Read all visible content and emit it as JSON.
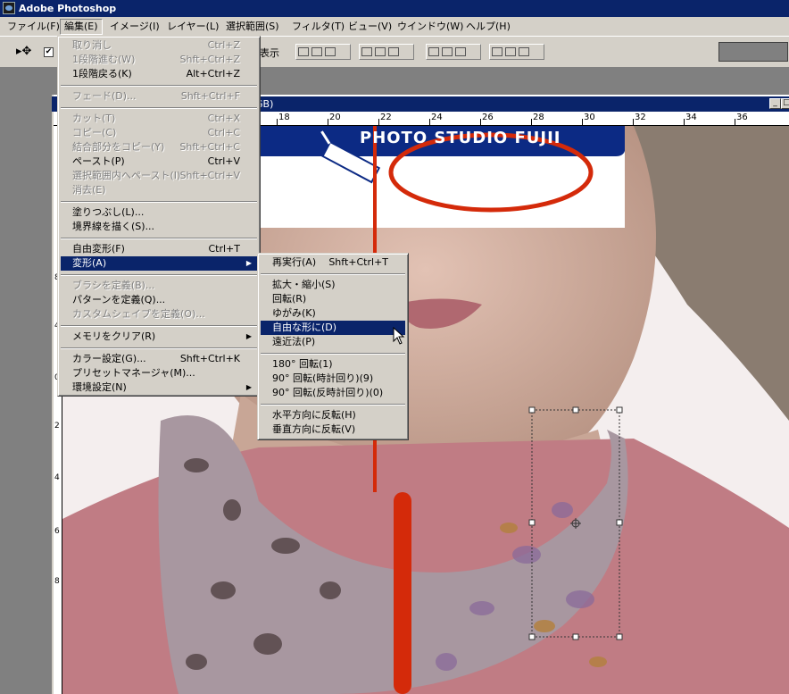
{
  "app": {
    "title": "Adobe Photoshop"
  },
  "menubar": [
    {
      "label": "ファイル(F)",
      "active": false
    },
    {
      "label": "編集(E)",
      "active": true
    },
    {
      "label": "イメージ(I)",
      "active": false
    },
    {
      "label": "レイヤー(L)",
      "active": false
    },
    {
      "label": "選択範囲(S)",
      "active": false
    },
    {
      "label": "フィルタ(T)",
      "active": false
    },
    {
      "label": "ビュー(V)",
      "active": false
    },
    {
      "label": "ウインドウ(W)",
      "active": false
    },
    {
      "label": "ヘルプ(H)",
      "active": false
    }
  ],
  "options_bar": {
    "show_label": "表示",
    "checkbox_checked": true,
    "tool_icon": "move-tool-icon"
  },
  "document": {
    "title_fragment": "GB)",
    "ruler_top": [
      "18",
      "20",
      "22",
      "24",
      "26",
      "28",
      "30",
      "32",
      "34",
      "36"
    ],
    "ruler_left": [
      "8",
      "4",
      "0",
      "2",
      "4",
      "6",
      "8"
    ]
  },
  "photo": {
    "banner_text": "PHOTO STUDIO FUJII"
  },
  "edit_menu": {
    "items": [
      {
        "type": "item",
        "label": "取り消し",
        "shortcut": "Ctrl+Z",
        "disabled": true
      },
      {
        "type": "item",
        "label": "1段階進む(W)",
        "shortcut": "Shft+Ctrl+Z",
        "disabled": true
      },
      {
        "type": "item",
        "label": "1段階戻る(K)",
        "shortcut": "Alt+Ctrl+Z",
        "disabled": false
      },
      {
        "type": "sep"
      },
      {
        "type": "item",
        "label": "フェード(D)...",
        "shortcut": "Shft+Ctrl+F",
        "disabled": true
      },
      {
        "type": "sep"
      },
      {
        "type": "item",
        "label": "カット(T)",
        "shortcut": "Ctrl+X",
        "disabled": true
      },
      {
        "type": "item",
        "label": "コピー(C)",
        "shortcut": "Ctrl+C",
        "disabled": true
      },
      {
        "type": "item",
        "label": "結合部分をコピー(Y)",
        "shortcut": "Shft+Ctrl+C",
        "disabled": true
      },
      {
        "type": "item",
        "label": "ペースト(P)",
        "shortcut": "Ctrl+V",
        "disabled": false
      },
      {
        "type": "item",
        "label": "選択範囲内へペースト(I)",
        "shortcut": "Shft+Ctrl+V",
        "disabled": true
      },
      {
        "type": "item",
        "label": "消去(E)",
        "shortcut": "",
        "disabled": true
      },
      {
        "type": "sep"
      },
      {
        "type": "item",
        "label": "塗りつぶし(L)...",
        "shortcut": "",
        "disabled": false
      },
      {
        "type": "item",
        "label": "境界線を描く(S)...",
        "shortcut": "",
        "disabled": false
      },
      {
        "type": "sep"
      },
      {
        "type": "item",
        "label": "自由変形(F)",
        "shortcut": "Ctrl+T",
        "disabled": false
      },
      {
        "type": "item",
        "label": "変形(A)",
        "shortcut": "",
        "disabled": false,
        "submenu": true,
        "highlighted": true
      },
      {
        "type": "sep"
      },
      {
        "type": "item",
        "label": "ブラシを定義(B)...",
        "shortcut": "",
        "disabled": true
      },
      {
        "type": "item",
        "label": "パターンを定義(Q)...",
        "shortcut": "",
        "disabled": false
      },
      {
        "type": "item",
        "label": "カスタムシェイプを定義(O)...",
        "shortcut": "",
        "disabled": true
      },
      {
        "type": "sep"
      },
      {
        "type": "item",
        "label": "メモリをクリア(R)",
        "shortcut": "",
        "disabled": false,
        "submenu": true
      },
      {
        "type": "sep"
      },
      {
        "type": "item",
        "label": "カラー設定(G)...",
        "shortcut": "Shft+Ctrl+K",
        "disabled": false
      },
      {
        "type": "item",
        "label": "プリセットマネージャ(M)...",
        "shortcut": "",
        "disabled": false
      },
      {
        "type": "item",
        "label": "環境設定(N)",
        "shortcut": "",
        "disabled": false,
        "submenu": true
      }
    ]
  },
  "transform_submenu": {
    "items": [
      {
        "type": "item",
        "label": "再実行(A)",
        "shortcut": "Shft+Ctrl+T"
      },
      {
        "type": "sep"
      },
      {
        "type": "item",
        "label": "拡大・縮小(S)",
        "shortcut": ""
      },
      {
        "type": "item",
        "label": "回転(R)",
        "shortcut": ""
      },
      {
        "type": "item",
        "label": "ゆがみ(K)",
        "shortcut": ""
      },
      {
        "type": "item",
        "label": "自由な形に(D)",
        "shortcut": "",
        "highlighted": true
      },
      {
        "type": "item",
        "label": "遠近法(P)",
        "shortcut": ""
      },
      {
        "type": "sep"
      },
      {
        "type": "item",
        "label": "180° 回転(1)",
        "shortcut": ""
      },
      {
        "type": "item",
        "label": "90° 回転(時計回り)(9)",
        "shortcut": ""
      },
      {
        "type": "item",
        "label": "90° 回転(反時計回り)(0)",
        "shortcut": ""
      },
      {
        "type": "sep"
      },
      {
        "type": "item",
        "label": "水平方向に反転(H)",
        "shortcut": ""
      },
      {
        "type": "item",
        "label": "垂直方向に反転(V)",
        "shortcut": ""
      }
    ]
  },
  "colors": {
    "menu_bg": "#d4d0c8",
    "highlight": "#0a246a",
    "titlebar": "#0a246a",
    "banner_blue": "#0c2a84",
    "red_line": "#d42a0a"
  }
}
